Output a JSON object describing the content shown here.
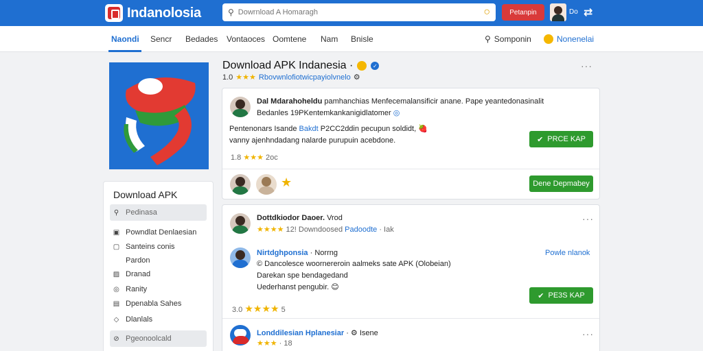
{
  "header": {
    "logo_text": "Indanolosia",
    "search_placeholder": "Dowrnload A Homaragh",
    "action_button": "Petanpin",
    "user_label": "Do",
    "icon_glyph": "⇄"
  },
  "nav": {
    "tabs": [
      "Naondi",
      "Sencr",
      "Bedades",
      "Vontaoces",
      "Oomtene",
      "Nam",
      "Bnisle"
    ],
    "search_label": "Somponin",
    "notifications_label": "Nonenelai"
  },
  "sidebar": {
    "title": "Download APK",
    "highlight_top": "Pedinasa",
    "items": [
      "Powndlat Denlaesian",
      "Santeins conis",
      "Pardon",
      "Dranad",
      "Ranity",
      "Dpenabla Sahes",
      "Dlanlals"
    ],
    "highlight_bottom": "Pgeonoolcald"
  },
  "app": {
    "title": "Download APK Indanesia ·",
    "rating": "1.0",
    "subtitle_link": "Rbovwnlofiotwicpayiolvnelo"
  },
  "review1": {
    "name": "Dal Mdarahoheldu",
    "headline_rest": "pamhanchias Menfecemalansificir anane. Pape yeantedonasinalit",
    "tag": "Bedanles",
    "tag_detail": "19PKentemkankanigidlatomer",
    "body_line1_a": "Pentenonars Isande",
    "body_line1_link": "Bakdt",
    "body_line1_b": "P2CC2ddin pecupun soldidt,",
    "body_line2": "vanny ajenhndadang nalarde purupuin acebdone.",
    "button": "PRCE KAP",
    "rating": "1.8",
    "count": "2oc",
    "button2": "Dene Depmabey"
  },
  "review2": {
    "name": "Dottdkiodor Daoer.",
    "name_suffix": "Vrod",
    "rating": "12!",
    "meta": "Downdoosed",
    "link": "Padoodte",
    "meta_end": "Iak"
  },
  "reply": {
    "name": "Nirtdghponsia",
    "name_suffix": "Norrng",
    "action": "Powle nlanok",
    "line1": "Dancolesce woornereroin aalmeks sate APK (Olobeian)",
    "line2": "Darekan spe bendagedand",
    "line3": "Uederhanst pengubir.",
    "rating": "3.0",
    "button": "PE3S KAP"
  },
  "review3": {
    "name": "Londdilesian Hplanesiar",
    "meta": "Isene",
    "rating": "18"
  }
}
